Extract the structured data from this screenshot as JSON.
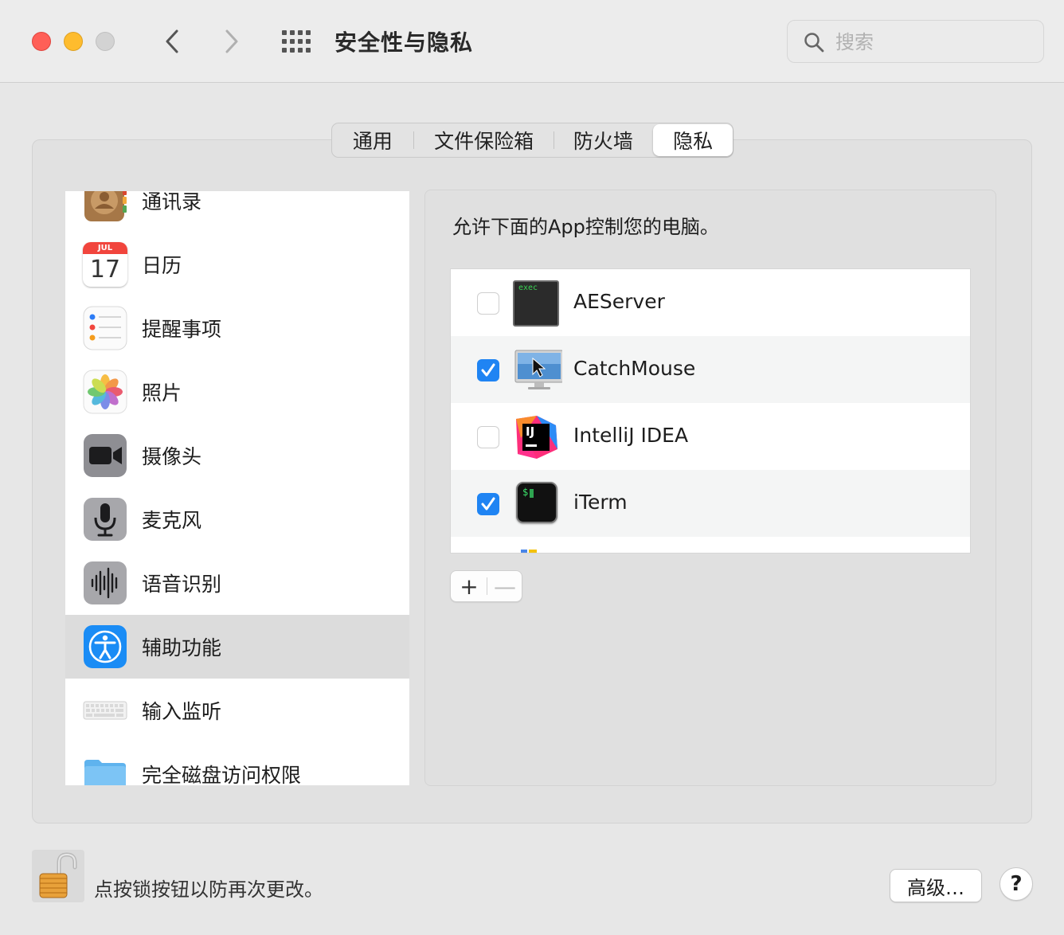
{
  "window": {
    "title": "安全性与隐私",
    "search_placeholder": "搜索"
  },
  "tabs": [
    {
      "label": "通用"
    },
    {
      "label": "文件保险箱"
    },
    {
      "label": "防火墙"
    },
    {
      "label": "隐私",
      "selected": true
    }
  ],
  "sidebar": {
    "items": [
      {
        "label": "通讯录",
        "icon": "contacts-icon"
      },
      {
        "label": "日历",
        "icon": "calendar-icon",
        "month": "JUL",
        "day": "17"
      },
      {
        "label": "提醒事项",
        "icon": "reminders-icon"
      },
      {
        "label": "照片",
        "icon": "photos-icon"
      },
      {
        "label": "摄像头",
        "icon": "camera-icon"
      },
      {
        "label": "麦克风",
        "icon": "microphone-icon"
      },
      {
        "label": "语音识别",
        "icon": "speech-recognition-icon"
      },
      {
        "label": "辅助功能",
        "icon": "accessibility-icon",
        "selected": true
      },
      {
        "label": "输入监听",
        "icon": "keyboard-icon"
      },
      {
        "label": "完全磁盘访问权限",
        "icon": "folder-icon"
      }
    ]
  },
  "panel": {
    "description": "允许下面的App控制您的电脑。",
    "apps": [
      {
        "name": "AEServer",
        "checked": false,
        "icon": "exec-terminal-icon",
        "icon_text": "exec"
      },
      {
        "name": "CatchMouse",
        "checked": true,
        "icon": "catchmouse-icon"
      },
      {
        "name": "IntelliJ IDEA",
        "checked": false,
        "icon": "intellij-icon",
        "icon_text": "IJ"
      },
      {
        "name": "iTerm",
        "checked": true,
        "icon": "iterm-icon",
        "icon_text": "$"
      }
    ],
    "add_label": "+",
    "remove_label": "—"
  },
  "footer": {
    "lock_text": "点按锁按钮以防再次更改。",
    "advanced_label": "高级…",
    "help_label": "?"
  },
  "colors": {
    "checkbox_on": "#1f84f3",
    "close": "#ff5f57",
    "minimize": "#febc2e",
    "selected_row": "#dcdcdc"
  }
}
